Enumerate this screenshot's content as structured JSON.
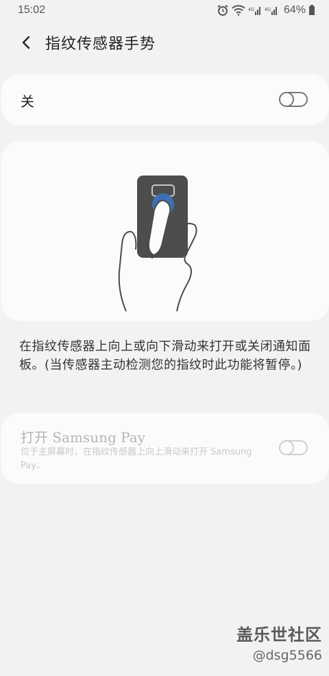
{
  "status_bar": {
    "time": "15:02",
    "battery": "64%",
    "icons": [
      "alarm-icon",
      "wifi-icon",
      "signal-icon",
      "signal-icon",
      "battery-icon"
    ]
  },
  "header": {
    "back_icon": "back-arrow-icon",
    "title": "指纹传感器手势"
  },
  "master_switch": {
    "label": "关",
    "on": false
  },
  "illustration": {
    "description_icon": "finger-swipe-on-phone-sensor"
  },
  "description": "在指纹传感器上向上或向下滑动来打开或关闭通知面板。(当传感器主动检测您的指纹时此功能将暂停。)",
  "samsung_pay": {
    "title": "打开 Samsung Pay",
    "subtitle": "位于主屏幕时，在指纹传感器上向上滑动来打开 Samsung Pay。",
    "on": false,
    "enabled": false
  },
  "watermark": {
    "title": "盖乐世社区",
    "handle": "@dsg5566"
  },
  "colors": {
    "background": "#f2f2f2",
    "card": "#fbfbfb",
    "sensor_blue": "#3d6fb3",
    "phone_body": "#4d4d4d"
  }
}
